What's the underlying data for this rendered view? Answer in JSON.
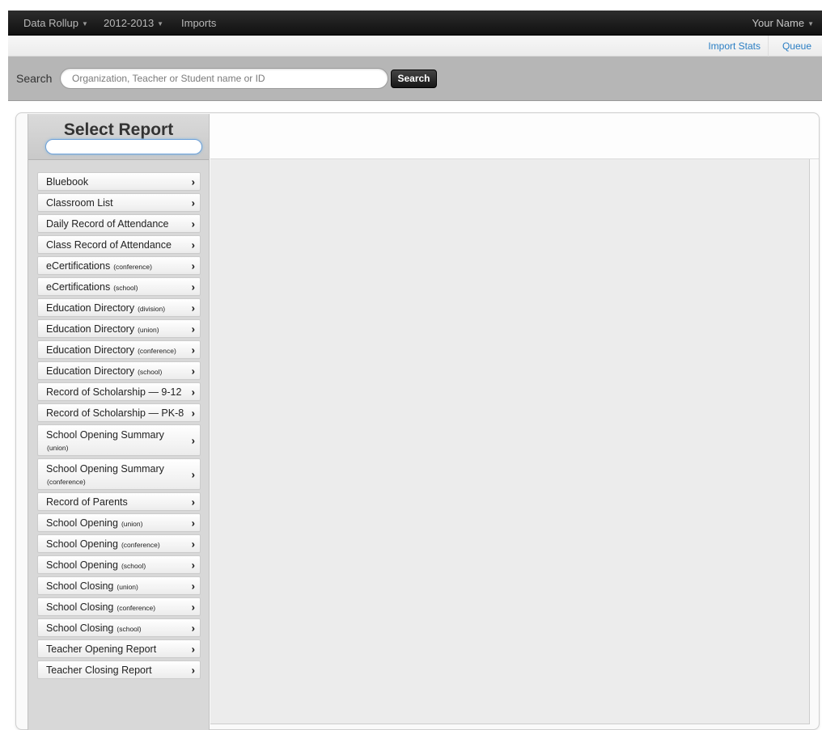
{
  "navbar": {
    "rollup_label": "Data Rollup",
    "year_label": "2012-2013",
    "imports_label": "Imports",
    "user_label": "Your Name"
  },
  "subbar": {
    "import_stats_label": "Import Stats",
    "queue_label": "Queue"
  },
  "search": {
    "label": "Search",
    "placeholder": "Organization, Teacher or Student name or ID",
    "button_label": "Search"
  },
  "sidebar": {
    "title": "Select Report",
    "filter_value": "",
    "items": [
      {
        "label": "Bluebook",
        "qualifier": ""
      },
      {
        "label": "Classroom List",
        "qualifier": ""
      },
      {
        "label": "Daily Record of Attendance",
        "qualifier": ""
      },
      {
        "label": "Class Record of Attendance",
        "qualifier": ""
      },
      {
        "label": "eCertifications",
        "qualifier": "(conference)"
      },
      {
        "label": "eCertifications",
        "qualifier": "(school)"
      },
      {
        "label": "Education Directory",
        "qualifier": "(division)"
      },
      {
        "label": "Education Directory",
        "qualifier": "(union)"
      },
      {
        "label": "Education Directory",
        "qualifier": "(conference)"
      },
      {
        "label": "Education Directory",
        "qualifier": "(school)"
      },
      {
        "label": "Record of Scholarship — 9-12",
        "qualifier": ""
      },
      {
        "label": "Record of Scholarship — PK-8",
        "qualifier": ""
      },
      {
        "label": "School Opening Summary",
        "qualifier": "(union)"
      },
      {
        "label": "School Opening Summary",
        "qualifier": "(conference)"
      },
      {
        "label": "Record of Parents",
        "qualifier": ""
      },
      {
        "label": "School Opening",
        "qualifier": "(union)"
      },
      {
        "label": "School Opening",
        "qualifier": "(conference)"
      },
      {
        "label": "School Opening",
        "qualifier": "(school)"
      },
      {
        "label": "School Closing",
        "qualifier": "(union)"
      },
      {
        "label": "School Closing",
        "qualifier": "(conference)"
      },
      {
        "label": "School Closing",
        "qualifier": "(school)"
      },
      {
        "label": "Teacher Opening Report",
        "qualifier": ""
      },
      {
        "label": "Teacher Closing Report",
        "qualifier": ""
      }
    ]
  },
  "icons": {
    "dropdown": "caret-down-icon",
    "report_arrow": "chevron-right-icon"
  },
  "colors": {
    "navbar": "#1b1b1b",
    "link": "#2a7ec4",
    "search_bar": "#b6b6b6",
    "sidebar": "#d8d8d8"
  }
}
